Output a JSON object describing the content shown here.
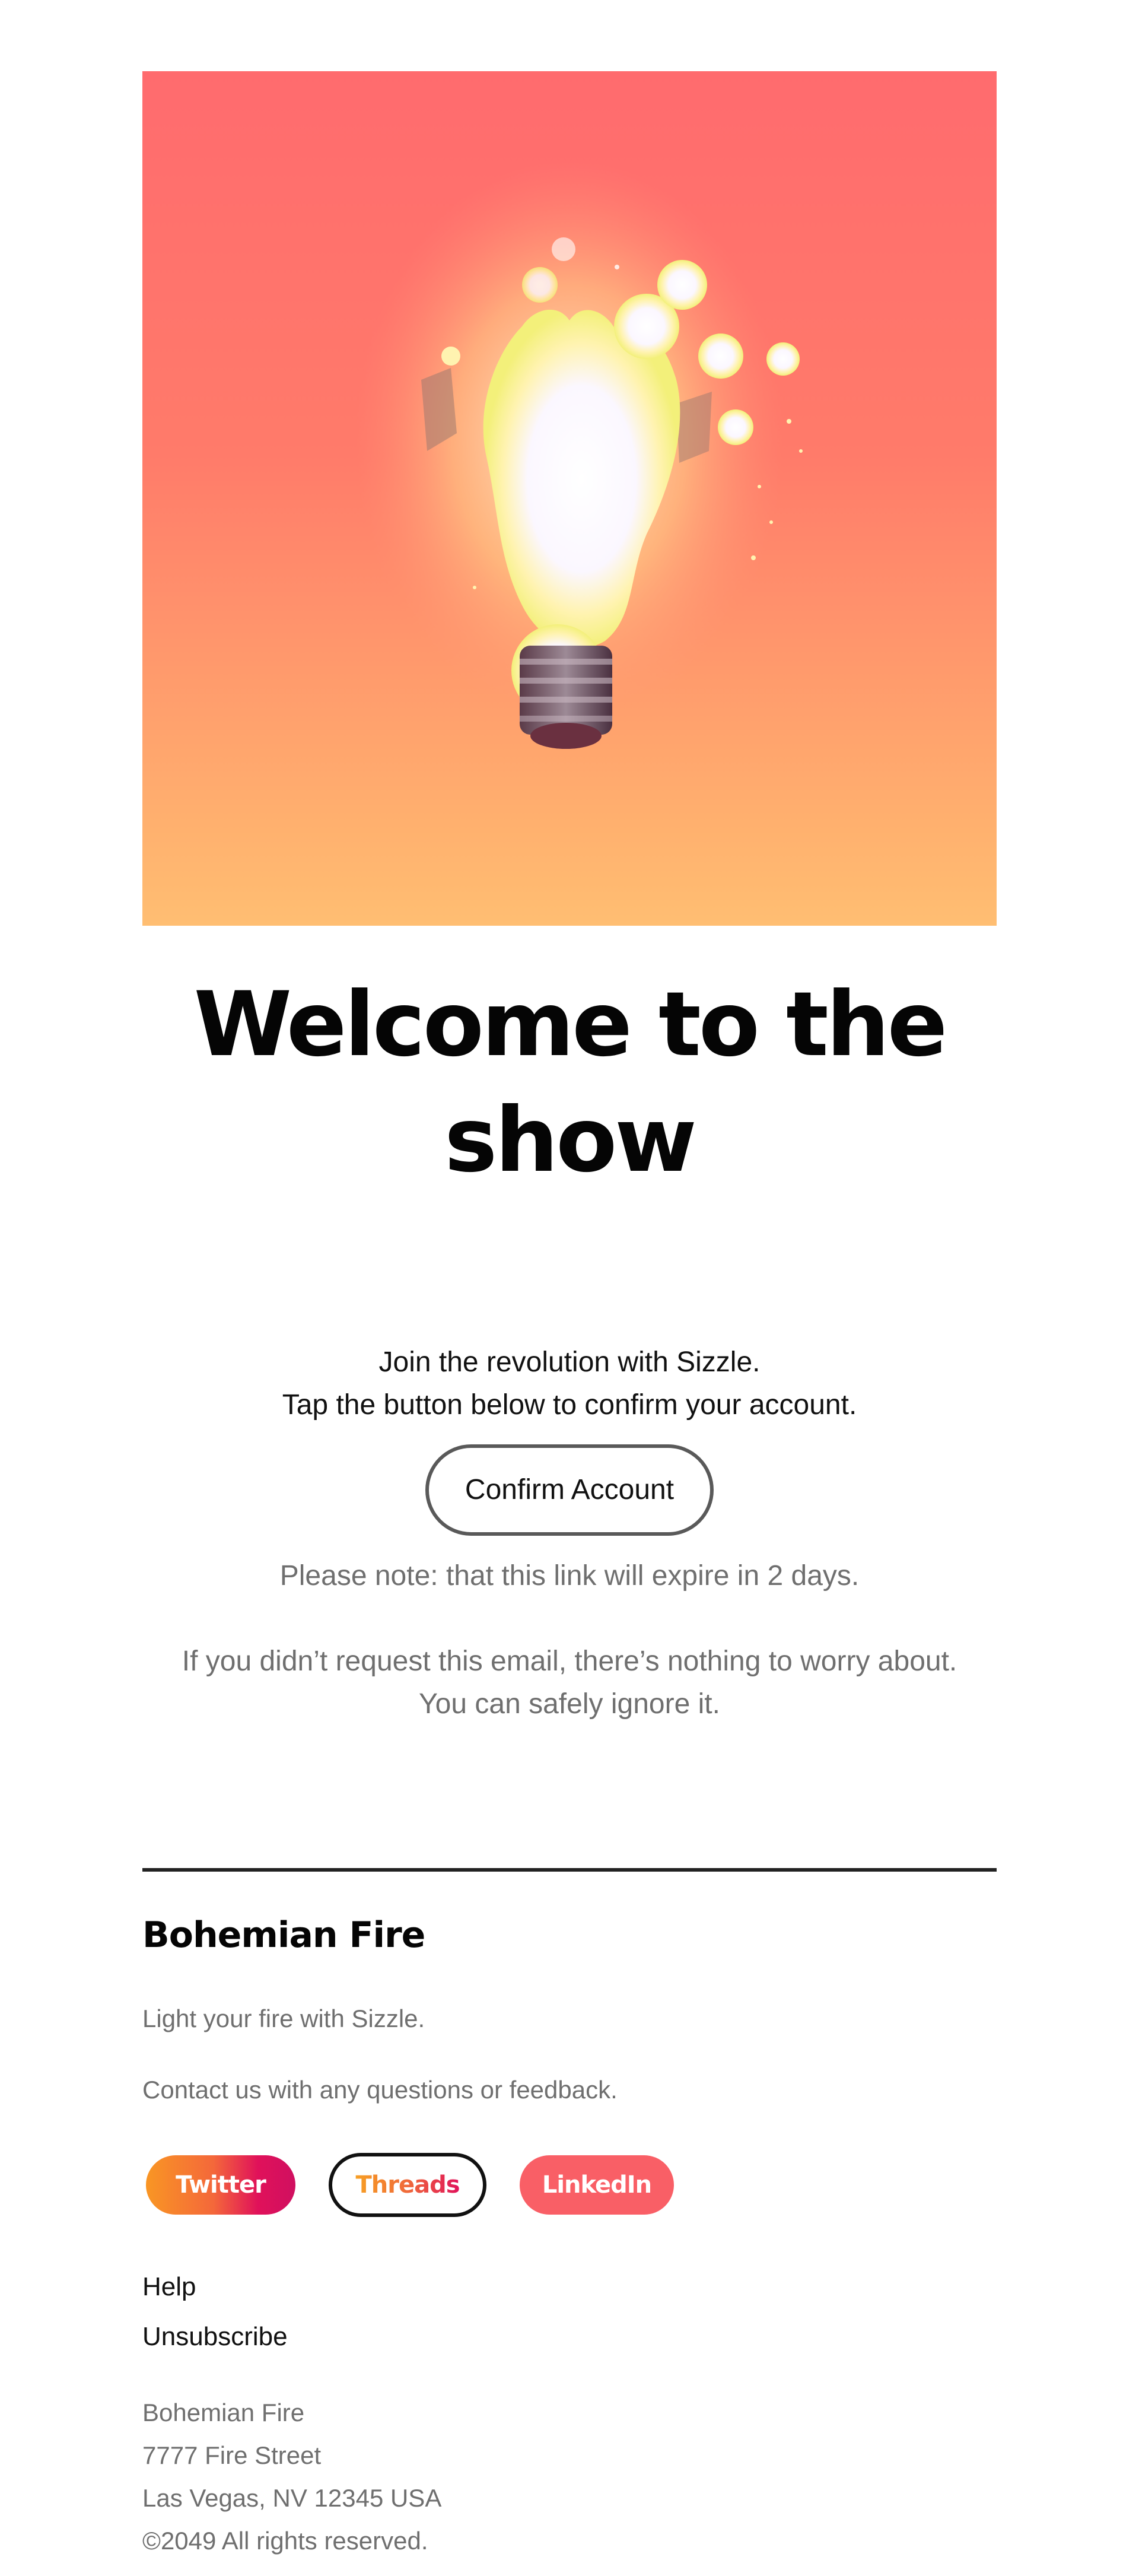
{
  "hero": {
    "image_label": "glowing light bulb illustration",
    "bg_top": "#ff6b6e",
    "bg_bottom": "#ffbe72"
  },
  "title": {
    "line1": "Welcome to the",
    "line2": "show"
  },
  "intro": {
    "line1": "Join the revolution with Sizzle.",
    "line2": "Tap the button below to confirm your account."
  },
  "cta": {
    "label": "Confirm Account"
  },
  "note": "Please note: that this link will expire in 2 days.",
  "disclaimer": {
    "line1": "If you didn’t request this email, there’s nothing to worry about.",
    "line2": "You can safely ignore it."
  },
  "footer": {
    "brand": "Bohemian Fire",
    "tagline": "Light your fire with Sizzle.",
    "contact": "Contact us with any questions or feedback.",
    "socials": [
      {
        "label": "Twitter",
        "icon": "twitter-pill"
      },
      {
        "label": "Threads",
        "icon": "threads-pill"
      },
      {
        "label": "LinkedIn",
        "icon": "linkedin-pill"
      }
    ],
    "links": [
      {
        "label": "Help"
      },
      {
        "label": "Unsubscribe"
      }
    ],
    "address": {
      "company": "Bohemian Fire",
      "street": "7777 Fire Street",
      "city": "Las Vegas, NV 12345 USA",
      "copyright": "©2049 All rights reserved."
    }
  },
  "colors": {
    "accent_coral": "#f95f66",
    "gradient_orange": "#f99624",
    "gradient_magenta": "#e0115a",
    "text_dark": "#111111",
    "text_muted": "#6f6f6f"
  }
}
